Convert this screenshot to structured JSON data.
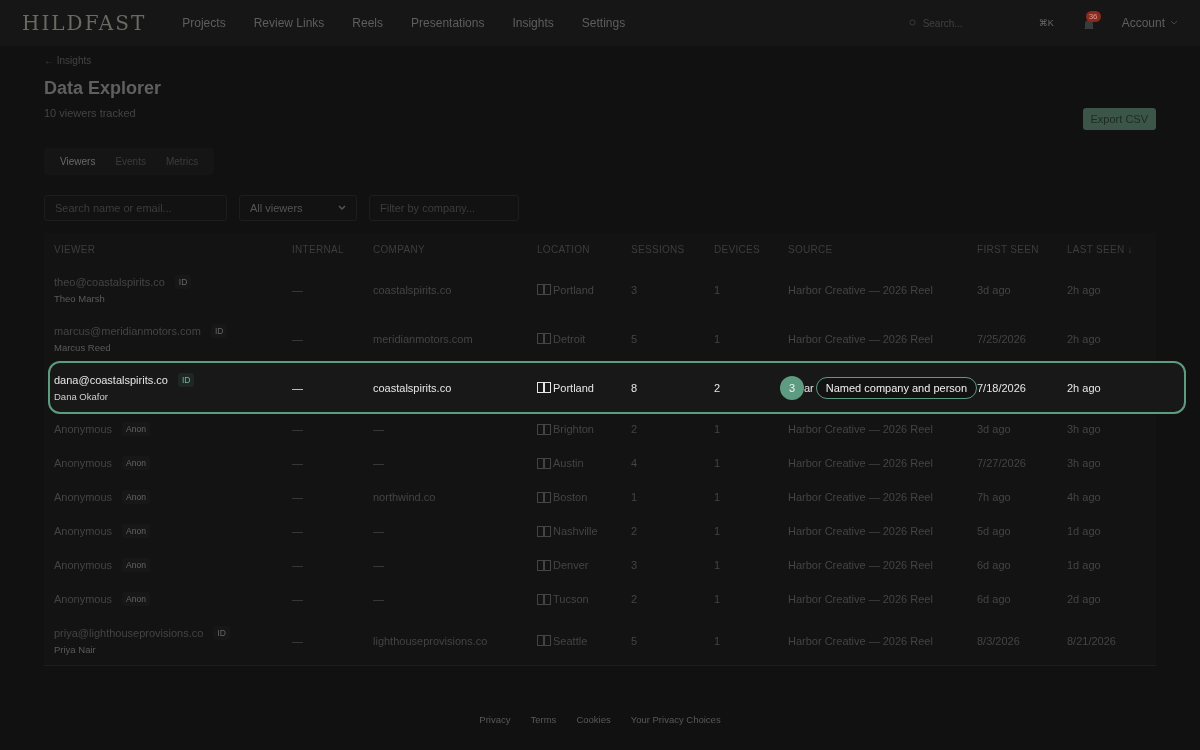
{
  "brand": "HILDFAST",
  "nav": [
    {
      "label": "Projects",
      "selected": false
    },
    {
      "label": "Review Links",
      "selected": false
    },
    {
      "label": "Reels",
      "selected": false
    },
    {
      "label": "Presentations",
      "selected": false
    },
    {
      "label": "Insights",
      "selected": false
    },
    {
      "label": "Settings",
      "selected": false
    }
  ],
  "search": {
    "placeholder": "Search...",
    "shortcut": "⌘K"
  },
  "notifications": {
    "count": "36"
  },
  "account": "Account",
  "back_link": "← Insights",
  "title": "Data Explorer",
  "subtitle": "10 viewers tracked",
  "export_button": "Export CSV",
  "tabs": [
    {
      "label": "Viewers",
      "selected": true
    },
    {
      "label": "Events",
      "selected": false
    },
    {
      "label": "Metrics",
      "selected": false
    }
  ],
  "filters": {
    "search_placeholder": "Search name or email...",
    "select_value": "All viewers",
    "company_placeholder": "Filter by company..."
  },
  "table": {
    "columns": [
      "VIEWER",
      "INTERNAL",
      "COMPANY",
      "LOCATION",
      "SESSIONS",
      "DEVICES",
      "SOURCE",
      "FIRST SEEN",
      "LAST SEEN ↓"
    ],
    "rows": [
      {
        "viewer": "theo@coastalspirits.co",
        "badge": "ID",
        "name": "Theo Marsh",
        "internal": "—",
        "company": "coastalspirits.co",
        "location": "Portland",
        "sessions": "3",
        "devices": "1",
        "source": "Harbor Creative — 2026 Reel",
        "first_seen": "3d ago",
        "last_seen": "2h ago",
        "highlighted": false
      },
      {
        "viewer": "marcus@meridianmotors.com",
        "badge": "ID",
        "name": "Marcus Reed",
        "internal": "—",
        "company": "meridianmotors.com",
        "location": "Detroit",
        "sessions": "5",
        "devices": "1",
        "source": "Harbor Creative — 2026 Reel",
        "first_seen": "7/25/2026",
        "last_seen": "2h ago",
        "highlighted": false
      },
      {
        "viewer": "dana@coastalspirits.co",
        "badge": "ID",
        "name": "Dana Okafor",
        "internal": "—",
        "company": "coastalspirits.co",
        "location": "Portland",
        "sessions": "8",
        "devices": "2",
        "source": "ar",
        "first_seen": "7/18/2026",
        "last_seen": "2h ago",
        "highlighted": true,
        "callout": {
          "number": "3",
          "label": "Named company and person"
        }
      },
      {
        "viewer": "Anonymous",
        "badge": "Anon",
        "internal": "—",
        "company": "—",
        "location": "Brighton",
        "sessions": "2",
        "devices": "1",
        "source": "Harbor Creative — 2026 Reel",
        "first_seen": "3d ago",
        "last_seen": "3h ago",
        "highlighted": false
      },
      {
        "viewer": "Anonymous",
        "badge": "Anon",
        "internal": "—",
        "company": "—",
        "location": "Austin",
        "sessions": "4",
        "devices": "1",
        "source": "Harbor Creative — 2026 Reel",
        "first_seen": "7/27/2026",
        "last_seen": "3h ago",
        "highlighted": false
      },
      {
        "viewer": "Anonymous",
        "badge": "Anon",
        "internal": "—",
        "company": "northwind.co",
        "location": "Boston",
        "sessions": "1",
        "devices": "1",
        "source": "Harbor Creative — 2026 Reel",
        "first_seen": "7h ago",
        "last_seen": "4h ago",
        "highlighted": false
      },
      {
        "viewer": "Anonymous",
        "badge": "Anon",
        "internal": "—",
        "company": "—",
        "location": "Nashville",
        "sessions": "2",
        "devices": "1",
        "source": "Harbor Creative — 2026 Reel",
        "first_seen": "5d ago",
        "last_seen": "1d ago",
        "highlighted": false
      },
      {
        "viewer": "Anonymous",
        "badge": "Anon",
        "internal": "—",
        "company": "—",
        "location": "Denver",
        "sessions": "3",
        "devices": "1",
        "source": "Harbor Creative — 2026 Reel",
        "first_seen": "6d ago",
        "last_seen": "1d ago",
        "highlighted": false
      },
      {
        "viewer": "Anonymous",
        "badge": "Anon",
        "internal": "—",
        "company": "—",
        "location": "Tucson",
        "sessions": "2",
        "devices": "1",
        "source": "Harbor Creative — 2026 Reel",
        "first_seen": "6d ago",
        "last_seen": "2d ago",
        "highlighted": false
      },
      {
        "viewer": "priya@lighthouseprovisions.co",
        "badge": "ID",
        "name": "Priya Nair",
        "internal": "—",
        "company": "lighthouseprovisions.co",
        "location": "Seattle",
        "sessions": "5",
        "devices": "1",
        "source": "Harbor Creative — 2026 Reel",
        "first_seen": "8/3/2026",
        "last_seen": "8/21/2026",
        "highlighted": false
      }
    ]
  },
  "footer_links": [
    "Privacy",
    "Terms",
    "Cookies",
    "Your Privacy Choices"
  ]
}
